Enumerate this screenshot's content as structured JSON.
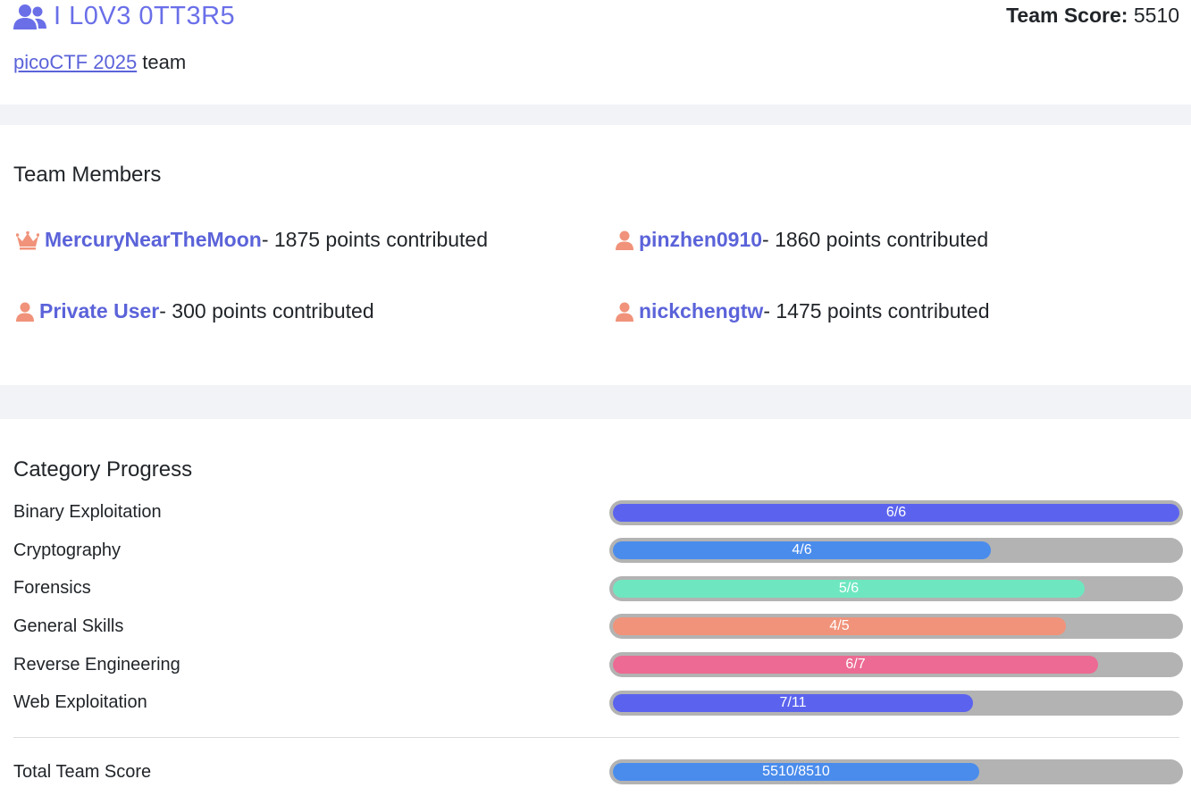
{
  "header": {
    "team_name": "I L0V3 0TT3R5",
    "team_score_label": "Team Score:",
    "team_score_value": "5510",
    "competition_link": "picoCTF 2025",
    "competition_suffix": " team"
  },
  "members_section": {
    "title": "Team Members",
    "members": [
      {
        "name": "MercuryNearTheMoon",
        "points_text": " - 1875 points contributed",
        "icon": "crown-icon"
      },
      {
        "name": "pinzhen0910",
        "points_text": " - 1860 points contributed",
        "icon": "user-icon"
      },
      {
        "name": "Private User",
        "points_text": " - 300 points contributed",
        "icon": "user-icon"
      },
      {
        "name": "nickchengtw",
        "points_text": " - 1475 points contributed",
        "icon": "user-icon"
      }
    ]
  },
  "progress_section": {
    "title": "Category Progress",
    "categories": [
      {
        "label": "Binary Exploitation",
        "solved": 6,
        "total": 6,
        "text": "6/6",
        "color": "#5b63ee"
      },
      {
        "label": "Cryptography",
        "solved": 4,
        "total": 6,
        "text": "4/6",
        "color": "#4a8cec"
      },
      {
        "label": "Forensics",
        "solved": 5,
        "total": 6,
        "text": "5/6",
        "color": "#6ee7c0"
      },
      {
        "label": "General Skills",
        "solved": 4,
        "total": 5,
        "text": "4/5",
        "color": "#f0937a"
      },
      {
        "label": "Reverse Engineering",
        "solved": 6,
        "total": 7,
        "text": "6/7",
        "color": "#ec6a93"
      },
      {
        "label": "Web Exploitation",
        "solved": 7,
        "total": 11,
        "text": "7/11",
        "color": "#5b63ee"
      }
    ],
    "total": {
      "label": "Total Team Score",
      "solved": 5510,
      "total": 8510,
      "text": "5510/8510",
      "color": "#4a8cec"
    }
  },
  "colors": {
    "accent": "#5b63d9",
    "icon": "#f0937a",
    "bar_track": "#b3b3b3"
  }
}
